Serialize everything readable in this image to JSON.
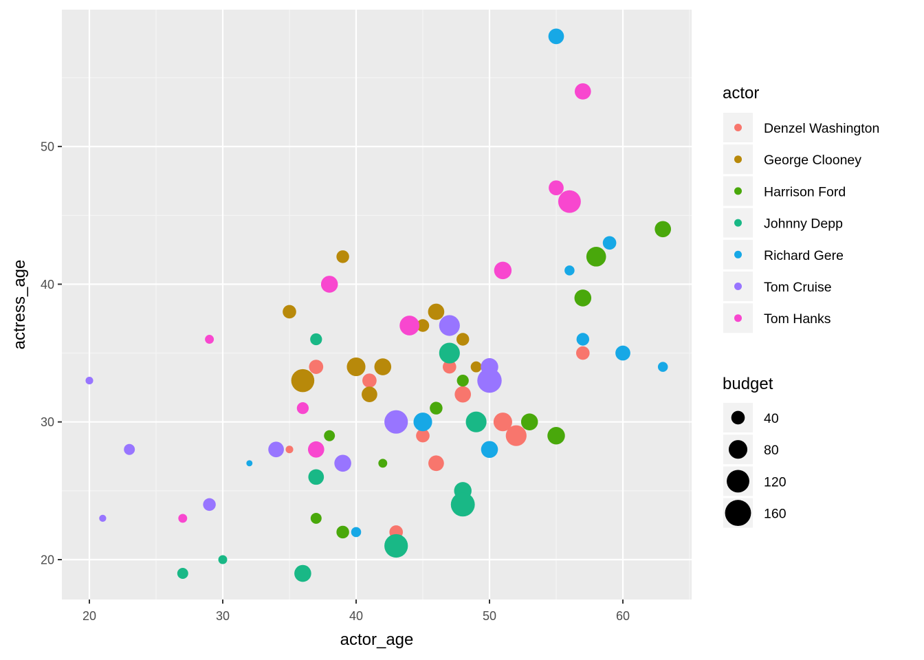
{
  "chart_data": {
    "type": "scatter",
    "title": "",
    "xlabel": "actor_age",
    "ylabel": "actress_age",
    "xlim": [
      18,
      65
    ],
    "ylim": [
      17,
      60
    ],
    "xticks": [
      20,
      30,
      40,
      50,
      60
    ],
    "yticks": [
      20,
      30,
      40,
      50
    ],
    "grid": true,
    "color_legend": {
      "title": "actor",
      "placement": "right",
      "entries": [
        {
          "name": "Denzel Washington",
          "color": "#F8766D"
        },
        {
          "name": "George Clooney",
          "color": "#B79F00"
        },
        {
          "name": "Harrison Ford",
          "color": "#00BA38"
        },
        {
          "name": "Johnny Depp",
          "color": "#00BFC4"
        },
        {
          "name": "Richard Gere",
          "color": "#619CFF"
        },
        {
          "name": "Tom Cruise",
          "color": "#F564E3"
        },
        {
          "name": "Tom Hanks",
          "color": "#FF61C3"
        }
      ]
    },
    "size_legend": {
      "title": "budget",
      "placement": "right",
      "values": [
        40,
        80,
        120,
        160
      ]
    },
    "series": [
      {
        "name": "Denzel Washington",
        "points": [
          {
            "x": 35,
            "y": 28,
            "budget": 10
          },
          {
            "x": 37,
            "y": 34,
            "budget": 45
          },
          {
            "x": 41,
            "y": 33,
            "budget": 45
          },
          {
            "x": 43,
            "y": 22,
            "budget": 40
          },
          {
            "x": 45,
            "y": 29,
            "budget": 40
          },
          {
            "x": 46,
            "y": 27,
            "budget": 55
          },
          {
            "x": 47,
            "y": 34,
            "budget": 40
          },
          {
            "x": 48,
            "y": 32,
            "budget": 60
          },
          {
            "x": 51,
            "y": 30,
            "budget": 80
          },
          {
            "x": 52,
            "y": 29,
            "budget": 100
          },
          {
            "x": 57,
            "y": 35,
            "budget": 40
          }
        ]
      },
      {
        "name": "George Clooney",
        "points": [
          {
            "x": 35,
            "y": 38,
            "budget": 40
          },
          {
            "x": 36,
            "y": 33,
            "budget": 125
          },
          {
            "x": 39,
            "y": 42,
            "budget": 35
          },
          {
            "x": 40,
            "y": 34,
            "budget": 80
          },
          {
            "x": 41,
            "y": 32,
            "budget": 55
          },
          {
            "x": 42,
            "y": 34,
            "budget": 65
          },
          {
            "x": 45,
            "y": 37,
            "budget": 35
          },
          {
            "x": 46,
            "y": 38,
            "budget": 60
          },
          {
            "x": 48,
            "y": 36,
            "budget": 35
          },
          {
            "x": 49,
            "y": 34,
            "budget": 25
          }
        ]
      },
      {
        "name": "Harrison Ford",
        "points": [
          {
            "x": 37,
            "y": 23,
            "budget": 25
          },
          {
            "x": 38,
            "y": 29,
            "budget": 25
          },
          {
            "x": 39,
            "y": 22,
            "budget": 35
          },
          {
            "x": 42,
            "y": 27,
            "budget": 15
          },
          {
            "x": 46,
            "y": 31,
            "budget": 35
          },
          {
            "x": 48,
            "y": 33,
            "budget": 30
          },
          {
            "x": 53,
            "y": 30,
            "budget": 65
          },
          {
            "x": 55,
            "y": 29,
            "budget": 70
          },
          {
            "x": 57,
            "y": 39,
            "budget": 65
          },
          {
            "x": 58,
            "y": 42,
            "budget": 90
          },
          {
            "x": 63,
            "y": 44,
            "budget": 60
          }
        ]
      },
      {
        "name": "Johnny Depp",
        "points": [
          {
            "x": 27,
            "y": 19,
            "budget": 25
          },
          {
            "x": 30,
            "y": 20,
            "budget": 15
          },
          {
            "x": 36,
            "y": 19,
            "budget": 65
          },
          {
            "x": 37,
            "y": 26,
            "budget": 55
          },
          {
            "x": 37,
            "y": 36,
            "budget": 30
          },
          {
            "x": 43,
            "y": 21,
            "budget": 130
          },
          {
            "x": 47,
            "y": 35,
            "budget": 100
          },
          {
            "x": 48,
            "y": 25,
            "budget": 70
          },
          {
            "x": 48,
            "y": 24,
            "budget": 135
          },
          {
            "x": 49,
            "y": 30,
            "budget": 100
          }
        ]
      },
      {
        "name": "Richard Gere",
        "points": [
          {
            "x": 32,
            "y": 27,
            "budget": 5
          },
          {
            "x": 40,
            "y": 22,
            "budget": 20
          },
          {
            "x": 43,
            "y": 30,
            "budget": 35
          },
          {
            "x": 45,
            "y": 30,
            "budget": 80
          },
          {
            "x": 50,
            "y": 28,
            "budget": 65
          },
          {
            "x": 55,
            "y": 58,
            "budget": 55
          },
          {
            "x": 56,
            "y": 41,
            "budget": 20
          },
          {
            "x": 57,
            "y": 36,
            "budget": 35
          },
          {
            "x": 59,
            "y": 43,
            "budget": 40
          },
          {
            "x": 60,
            "y": 35,
            "budget": 50
          },
          {
            "x": 63,
            "y": 34,
            "budget": 20
          }
        ]
      },
      {
        "name": "Tom Cruise",
        "points": [
          {
            "x": 20,
            "y": 33,
            "budget": 10
          },
          {
            "x": 21,
            "y": 23,
            "budget": 8
          },
          {
            "x": 23,
            "y": 28,
            "budget": 25
          },
          {
            "x": 29,
            "y": 24,
            "budget": 35
          },
          {
            "x": 34,
            "y": 28,
            "budget": 55
          },
          {
            "x": 39,
            "y": 27,
            "budget": 65
          },
          {
            "x": 43,
            "y": 30,
            "budget": 130
          },
          {
            "x": 47,
            "y": 37,
            "budget": 100
          },
          {
            "x": 50,
            "y": 34,
            "budget": 70
          },
          {
            "x": 50,
            "y": 33,
            "budget": 140
          }
        ]
      },
      {
        "name": "Tom Hanks",
        "points": [
          {
            "x": 27,
            "y": 23,
            "budget": 15
          },
          {
            "x": 29,
            "y": 36,
            "budget": 15
          },
          {
            "x": 36,
            "y": 31,
            "budget": 30
          },
          {
            "x": 37,
            "y": 28,
            "budget": 60
          },
          {
            "x": 38,
            "y": 40,
            "budget": 65
          },
          {
            "x": 44,
            "y": 37,
            "budget": 90
          },
          {
            "x": 51,
            "y": 41,
            "budget": 70
          },
          {
            "x": 55,
            "y": 47,
            "budget": 50
          },
          {
            "x": 56,
            "y": 46,
            "budget": 120
          },
          {
            "x": 57,
            "y": 54,
            "budget": 60
          }
        ]
      }
    ]
  }
}
